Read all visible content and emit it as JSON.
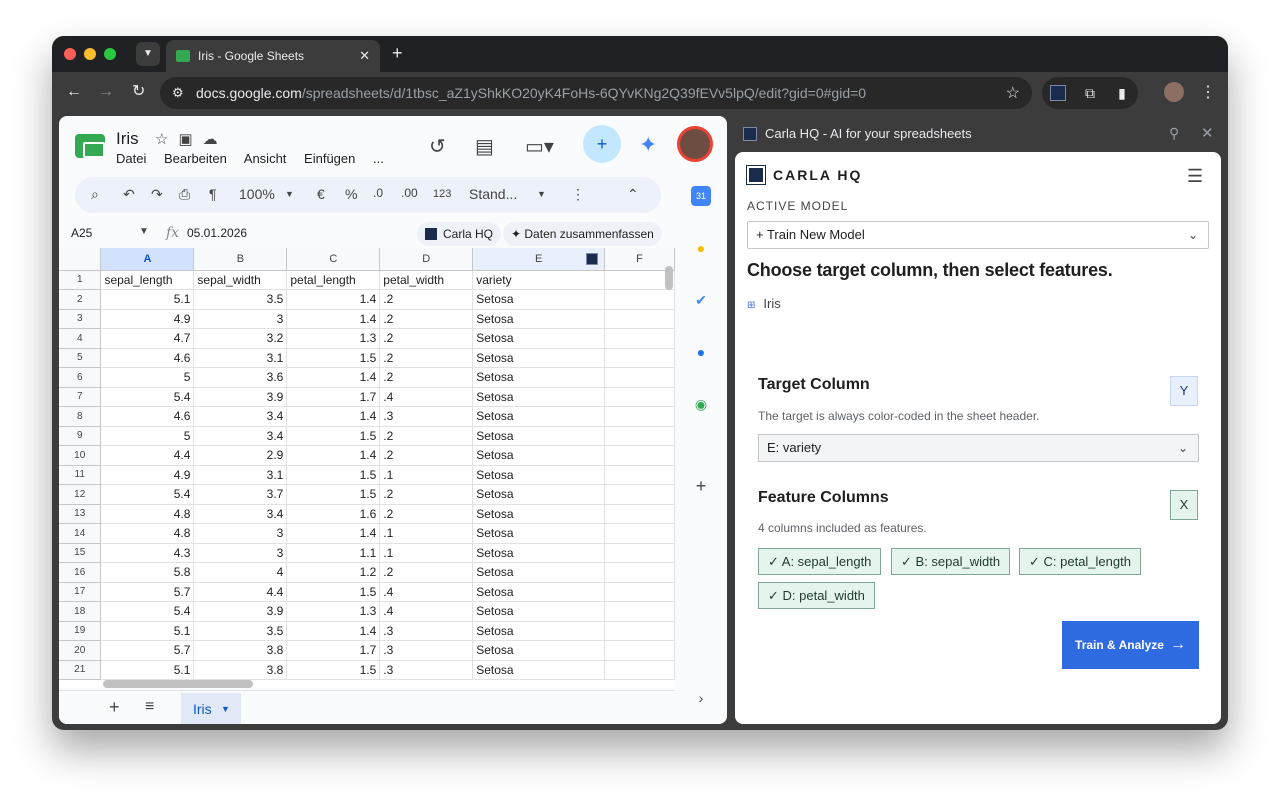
{
  "browser": {
    "tab_title": "Iris - Google Sheets",
    "url_host": "docs.google.com",
    "url_path": "/spreadsheets/d/1tbsc_aZ1yShkKO20yK4FoHs-6QYvKNg2Q39fEVv5lpQ/edit?gid=0#gid=0"
  },
  "sheets": {
    "title": "Iris",
    "menu": [
      "Datei",
      "Bearbeiten",
      "Ansicht",
      "Einfügen",
      "..."
    ],
    "toolbar": {
      "zoom": "100%",
      "currency": "€",
      "percent": "%",
      "dec_decrease": ".0",
      "dec_increase": ".00",
      "number_format": "123",
      "format_default": "Stand..."
    },
    "name_box": "A25",
    "fx_label": "fx",
    "formula_value": "05.01.2026",
    "chips": [
      "Carla HQ",
      "Daten zusammenfassen"
    ],
    "column_headers": [
      "A",
      "B",
      "C",
      "D",
      "E",
      "F"
    ],
    "rows": [
      [
        "sepal_length",
        "sepal_width",
        "petal_length",
        "petal_width",
        "variety"
      ],
      [
        "5.1",
        "3.5",
        "1.4",
        ".2",
        "Setosa"
      ],
      [
        "4.9",
        "3",
        "1.4",
        ".2",
        "Setosa"
      ],
      [
        "4.7",
        "3.2",
        "1.3",
        ".2",
        "Setosa"
      ],
      [
        "4.6",
        "3.1",
        "1.5",
        ".2",
        "Setosa"
      ],
      [
        "5",
        "3.6",
        "1.4",
        ".2",
        "Setosa"
      ],
      [
        "5.4",
        "3.9",
        "1.7",
        ".4",
        "Setosa"
      ],
      [
        "4.6",
        "3.4",
        "1.4",
        ".3",
        "Setosa"
      ],
      [
        "5",
        "3.4",
        "1.5",
        ".2",
        "Setosa"
      ],
      [
        "4.4",
        "2.9",
        "1.4",
        ".2",
        "Setosa"
      ],
      [
        "4.9",
        "3.1",
        "1.5",
        ".1",
        "Setosa"
      ],
      [
        "5.4",
        "3.7",
        "1.5",
        ".2",
        "Setosa"
      ],
      [
        "4.8",
        "3.4",
        "1.6",
        ".2",
        "Setosa"
      ],
      [
        "4.8",
        "3",
        "1.4",
        ".1",
        "Setosa"
      ],
      [
        "4.3",
        "3",
        "1.1",
        ".1",
        "Setosa"
      ],
      [
        "5.8",
        "4",
        "1.2",
        ".2",
        "Setosa"
      ],
      [
        "5.7",
        "4.4",
        "1.5",
        ".4",
        "Setosa"
      ],
      [
        "5.4",
        "3.9",
        "1.3",
        ".4",
        "Setosa"
      ],
      [
        "5.1",
        "3.5",
        "1.4",
        ".3",
        "Setosa"
      ],
      [
        "5.7",
        "3.8",
        "1.7",
        ".3",
        "Setosa"
      ],
      [
        "5.1",
        "3.8",
        "1.5",
        ".3",
        "Setosa"
      ]
    ],
    "sheet_tab": "Iris"
  },
  "panel": {
    "header_title": "Carla HQ - AI for your spreadsheets",
    "brand": "CARLA HQ",
    "active_model_label": "ACTIVE MODEL",
    "active_model_value": "+ Train New Model",
    "headline": "Choose target column, then select features.",
    "sheet_name": "Iris",
    "target": {
      "title": "Target Column",
      "badge": "Y",
      "description": "The target is always color-coded in the sheet header.",
      "selected": "E: variety"
    },
    "features": {
      "title": "Feature Columns",
      "badge": "X",
      "description": "4 columns included as features.",
      "items": [
        "✓ A: sepal_length",
        "✓ B: sepal_width",
        "✓ C: petal_length",
        "✓ D: petal_width"
      ]
    },
    "train_button": "Train & Analyze"
  },
  "colors": {
    "accent_blue": "#2f6be0",
    "feature_green": "#e6f4ee",
    "target_blue": "#e8f0fe",
    "sheets_green": "#34a853"
  },
  "icons": [
    "search-icon",
    "undo-icon",
    "redo-icon",
    "print-icon",
    "paint-format-icon",
    "history-icon",
    "comment-icon",
    "video-icon",
    "share-icon",
    "gemini-icon",
    "calendar-icon",
    "keep-icon",
    "tasks-icon",
    "contacts-icon",
    "maps-icon",
    "plus-icon",
    "hamburger-icon",
    "arrow-right-icon"
  ]
}
